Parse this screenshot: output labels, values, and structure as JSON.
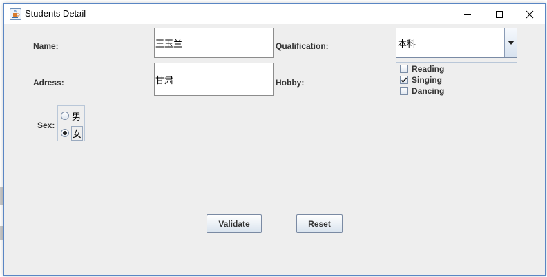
{
  "window": {
    "title": "Students Detail"
  },
  "form": {
    "name_label": "Name:",
    "name_value": "王玉兰",
    "address_label": "Adress:",
    "address_value": "甘肃",
    "qualification_label": "Qualification:",
    "qualification_value": "本科",
    "hobby_label": "Hobby:",
    "hobbies": [
      {
        "label": "Reading",
        "checked": false
      },
      {
        "label": "Singing",
        "checked": true
      },
      {
        "label": "Dancing",
        "checked": false
      }
    ],
    "sex_label": "Sex:",
    "sex_options": [
      {
        "label": "男",
        "selected": false
      },
      {
        "label": "女",
        "selected": true
      }
    ]
  },
  "buttons": {
    "validate": "Validate",
    "reset": "Reset"
  },
  "icons": {
    "app": "java-cup-icon",
    "minimize": "minimize-icon",
    "maximize": "maximize-icon",
    "close": "close-icon",
    "dropdown": "dropdown-arrow-icon"
  },
  "colors": {
    "window_border": "#5a86c4",
    "content_bg": "#eeeeee",
    "label_text": "#333333"
  }
}
